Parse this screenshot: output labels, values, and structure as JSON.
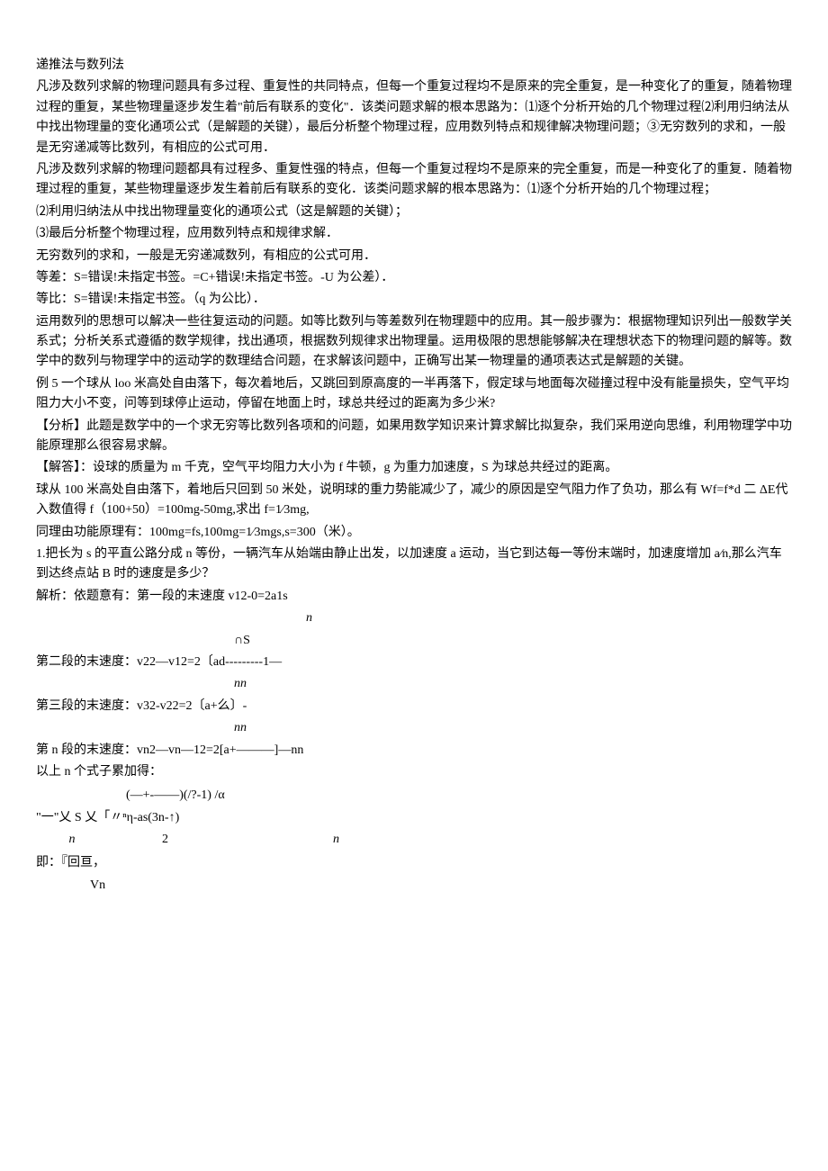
{
  "title": "递推法与数列法",
  "para1": "凡涉及数列求解的物理问题具有多过程、重复性的共同特点，但每一个重复过程均不是原来的完全重复，是一种变化了的重复，随着物理过程的重复，某些物理量逐步发生着\"前后有联系的变化\"．该类问题求解的根本思路为：⑴逐个分析开始的几个物理过程⑵利用归纳法从中找出物理量的变化通项公式（是解题的关键），最后分析整个物理过程，应用数列特点和规律解决物理问题；③无穷数列的求和，一般是无穷递减等比数列，有相应的公式可用．",
  "para2": "凡涉及数列求解的物理问题都具有过程多、重复性强的特点，但每一个重复过程均不是原来的完全重复，而是一种变化了的重复．随着物理过程的重复，某些物理量逐步发生着前后有联系的变化．该类问题求解的根本思路为：⑴逐个分析开始的几个物理过程；",
  "para3": "⑵利用归纳法从中找出物理量变化的通项公式（这是解题的关键）；",
  "para4": "⑶最后分析整个物理过程，应用数列特点和规律求解．",
  "para5": "无穷数列的求和，一般是无穷递减数列，有相应的公式可用．",
  "para6": "等差：S=错误!未指定书签。=C+错误!未指定书签。-U 为公差）．",
  "para7": "等比：S=错误!未指定书签。（q 为公比）．",
  "para8": "运用数列的思想可以解决一些往复运动的问题。如等比数列与等差数列在物理题中的应用。其一般步骤为：根据物理知识列出一般数学关系式；分析关系式遵循的数学规律，找出通项，根据数列规律求出物理量。运用极限的思想能够解决在理想状态下的物理问题的解等。数学中的数列与物理学中的运动学的数理结合问题，在求解该问题中，正确写出某一物理量的通项表达式是解题的关键。",
  "para9": "例 5 一个球从 loo 米高处自由落下，每次着地后，又跳回到原高度的一半再落下，假定球与地面每次碰撞过程中没有能量损失，空气平均阻力大小不变，问等到球停止运动，停留在地面上时，球总共经过的距离为多少米?",
  "para10": "【分析】此题是数学中的一个求无穷等比数列各项和的问题，如果用数学知识来计算求解比拟复杂，我们采用逆向思维，利用物理学中功能原理那么很容易求解。",
  "para11": "【解答】：设球的质量为 m 千克，空气平均阻力大小为 f 牛顿，g 为重力加速度，S 为球总共经过的距离。",
  "para12": "球从 100 米高处自由落下，着地后只回到 50 米处，说明球的重力势能减少了，减少的原因是空气阻力作了负功，那么有 Wf=f*d 二 ΔE代入数值得 f（100+50）=100mg-50mg,求出 f=1⁄3mg,",
  "para13": "同理由功能原理有：100mg=fs,100mg=1⁄3mgs,s=300（米）。",
  "para14": "1.把长为 s 的平直公路分成 n 等份，一辆汽车从始端由静止出发，以加速度 a 运动，当它到达每一等份末端时，加速度增加 a⁄n,那么汽车到达终点站 B 时的速度是多少？",
  "para15": "解析：依题意有：第一段的末速度 v12-0=2a1s",
  "formula_n1": "n",
  "formula_cap_s": "∩S",
  "para16": "第二段的末速度：v22—v12=2〔ad---------1—",
  "formula_nn1": "nn",
  "para17": "第三段的末速度：v32-v22=2〔a+么〕-",
  "formula_nn2": "nn",
  "para18": "第 n 段的末速度：vn2—vn—12=2[a+———]—nn",
  "para19": "以上 n 个式子累加得：",
  "formula_top": "(—+-——)(/?-1)         /α",
  "formula_mid": "\"一\"乂 S 乂「〃ⁿη-as(3n-↑)",
  "formula_n_left": "n",
  "formula_2": "2",
  "formula_n_right": "n",
  "para20": "即：『回亘，",
  "formula_vn": "Vn"
}
